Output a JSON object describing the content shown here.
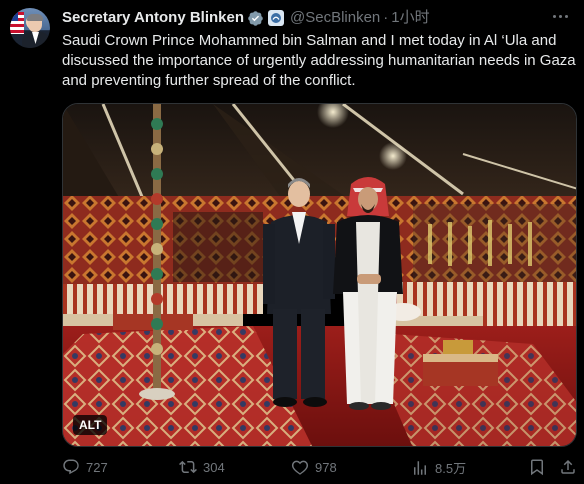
{
  "tweet": {
    "author_name": "Secretary Antony Blinken",
    "handle": "@SecBlinken",
    "separator": "·",
    "time": "1小时",
    "text": "Saudi Crown Prince Mohammed bin Salman and I met today in Al ‘Ula and discussed the importance of urgently addressing humanitarian needs in Gaza and preventing further spread of the conflict.",
    "media": {
      "alt_badge": "ALT"
    },
    "metrics": {
      "replies": "727",
      "retweets": "304",
      "likes": "978",
      "views": "8.5万"
    },
    "icons": {
      "verified": "verified-badge-icon",
      "affiliation": "government-affiliation-icon",
      "more": "more-options-icon",
      "reply": "reply-icon",
      "retweet": "retweet-icon",
      "like": "heart-icon",
      "views": "views-chart-icon",
      "bookmark": "bookmark-icon",
      "share": "share-icon"
    },
    "colors": {
      "background": "#000000",
      "text": "#e7e9ea",
      "muted": "#71767b",
      "verified": "#1d9bf0"
    }
  }
}
